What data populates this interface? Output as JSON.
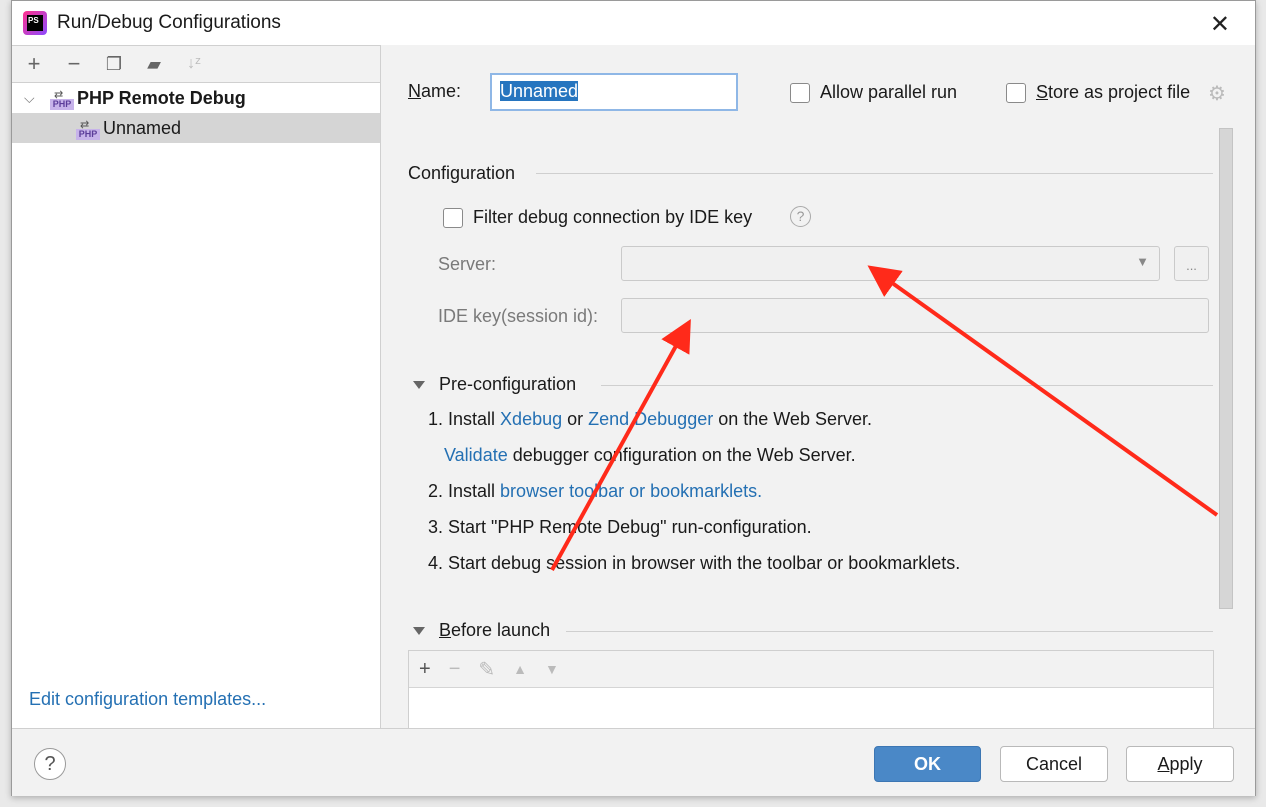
{
  "window": {
    "title": "Run/Debug Configurations",
    "close_icon": "close-icon"
  },
  "sidebar": {
    "toolbar": [
      "add-icon",
      "remove-icon",
      "copy-icon",
      "new-folder-icon",
      "sort-az-icon"
    ],
    "tree": [
      {
        "label": "PHP Remote Debug",
        "expanded": true
      },
      {
        "label": "Unnamed",
        "selected": true
      }
    ],
    "edit_templates": "Edit configuration templates..."
  },
  "form": {
    "name_label": "Name:",
    "name_value": "Unnamed",
    "allow_parallel": "Allow parallel run",
    "store_project": "Store as project file",
    "configuration": "Configuration",
    "filter_label": "Filter debug connection by IDE key",
    "server_label": "Server:",
    "server_value": "",
    "more_btn": "...",
    "idekey_label": "IDE key(session id):",
    "idekey_value": ""
  },
  "preconfig": {
    "title": "Pre-configuration",
    "step1_a": "1. Install ",
    "xdebug": "Xdebug",
    "or": " or ",
    "zend": "Zend Debugger",
    "step1_b": " on the Web Server.",
    "validate": "Validate",
    "validate_rest": " debugger configuration on the Web Server.",
    "step2_a": "2. Install ",
    "step2_link": "browser toolbar or bookmarklets.",
    "step3": "3. Start \"PHP Remote Debug\" run-configuration.",
    "step4": "4. Start debug session in browser with the toolbar or bookmarklets."
  },
  "before_launch": {
    "title": "Before launch",
    "toolbar": [
      "add-icon",
      "remove-icon",
      "edit-icon",
      "move-up-icon",
      "move-down-icon"
    ]
  },
  "buttons": {
    "help": "?",
    "ok": "OK",
    "cancel": "Cancel",
    "apply": "Apply"
  },
  "colors": {
    "accent": "#4a88c7",
    "link": "#2470b3",
    "annotation": "#ff2a1a"
  }
}
